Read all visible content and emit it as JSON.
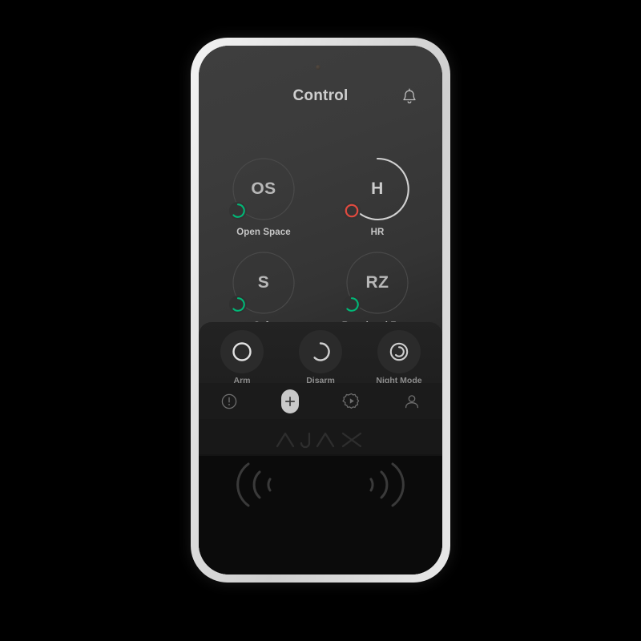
{
  "device": {
    "brand": "AJAX",
    "brand_icon": "ajax-wordmark",
    "reader_icon_left": "nfc-waves-left-icon",
    "reader_icon_right": "nfc-waves-right-icon",
    "sensor_icon": "proximity-sensor-dot"
  },
  "header": {
    "title": "Control",
    "bell_icon": "bell-icon"
  },
  "groups": [
    {
      "abbr": "OS",
      "label": "Open Space",
      "state": "disarmed",
      "state_color": "#00b877",
      "badge_icon": "disarmed-arc-icon",
      "selected": false
    },
    {
      "abbr": "H",
      "label": "HR",
      "state": "alarm",
      "state_color": "#e04a3f",
      "badge_icon": "alarm-circle-icon",
      "selected": true
    },
    {
      "abbr": "S",
      "label": "Safe",
      "state": "disarmed",
      "state_color": "#00b877",
      "badge_icon": "disarmed-arc-icon",
      "selected": false
    },
    {
      "abbr": "RZ",
      "label": "Restricted Zone",
      "state": "disarmed",
      "state_color": "#00b877",
      "badge_icon": "disarmed-arc-icon",
      "selected": false
    }
  ],
  "controls": [
    {
      "label": "Arm",
      "icon": "arm-circle-icon"
    },
    {
      "label": "Disarm",
      "icon": "disarm-arc-icon"
    },
    {
      "label": "Night Mode",
      "icon": "night-mode-icon"
    }
  ],
  "nav": [
    {
      "name": "alerts",
      "icon": "exclamation-circle-icon",
      "active": false
    },
    {
      "name": "add",
      "icon": "plus-icon",
      "active": true
    },
    {
      "name": "scenarios",
      "icon": "gear-play-icon",
      "active": false
    },
    {
      "name": "profile",
      "icon": "person-icon",
      "active": false
    }
  ],
  "colors": {
    "bezel": "#dcdcdc",
    "screen_top": "#3e3e3e",
    "screen_bottom": "#222222",
    "accent_green": "#00b877",
    "accent_red": "#e04a3f",
    "ring_active": "#d2d2d2",
    "ring_idle": "#4a4a4a"
  }
}
